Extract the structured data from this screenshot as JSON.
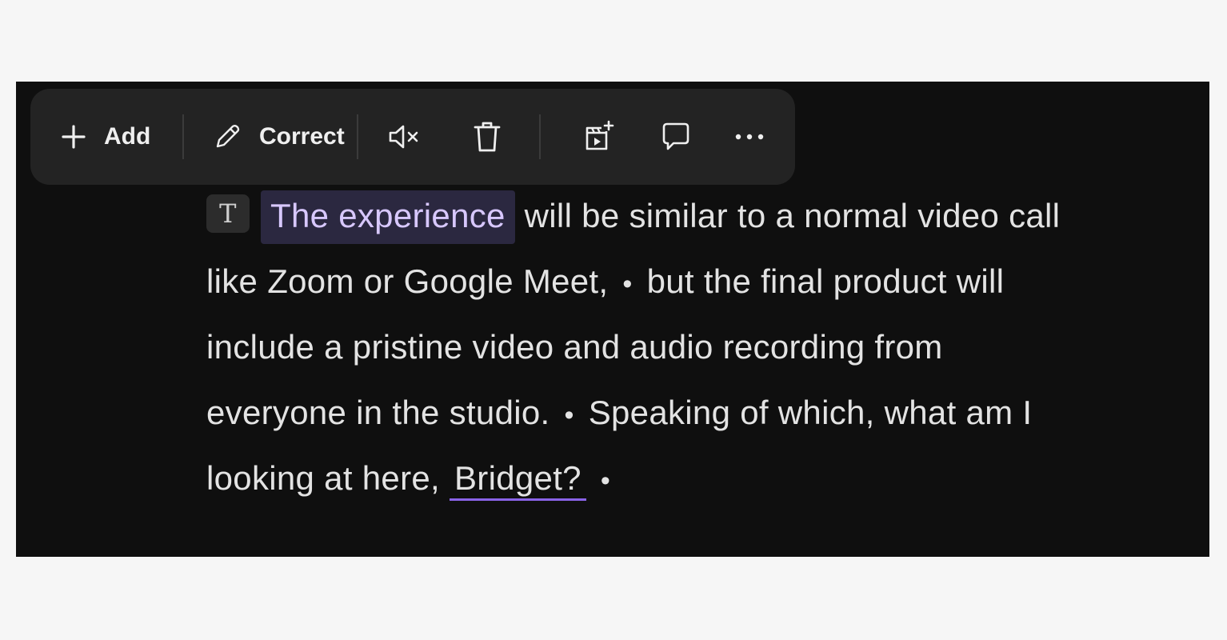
{
  "toolbar": {
    "add_label": "Add",
    "correct_label": "Correct",
    "icons": {
      "add": "plus-icon",
      "correct": "pencil-icon",
      "mute": "mute-icon",
      "delete": "trash-icon",
      "clip": "add-clip-icon",
      "comment": "comment-icon",
      "more": "more-icon"
    }
  },
  "transcript": {
    "badge": "T",
    "highlighted_text": "The experience",
    "line1_rest": " will be similar to a normal video call",
    "line2_a": "like Zoom or Google Meet,",
    "bullet": "•",
    "line2_b": "but the final product will",
    "line3": "include a pristine video and audio recording from",
    "line4_a": "everyone in the studio.",
    "line4_b": "Speaking of which, what am I",
    "line5_a": "looking at here,",
    "line5_underlined": "Bridget?",
    "colors": {
      "highlight_bg": "#2b2840",
      "highlight_text": "#d8c8ff",
      "underline": "#8a63e8"
    }
  }
}
